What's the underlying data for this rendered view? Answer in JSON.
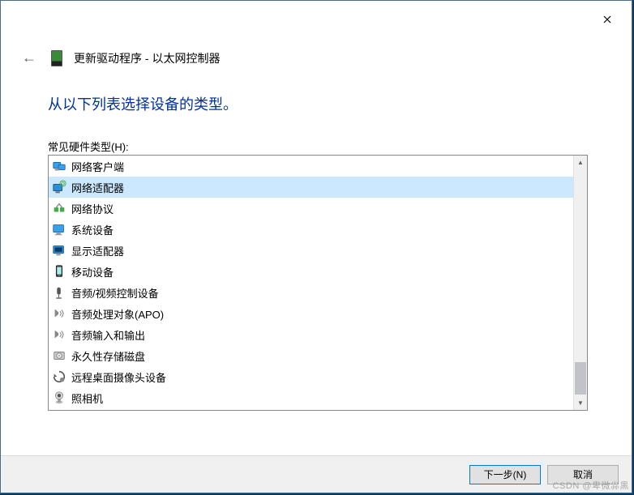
{
  "window": {
    "title": "更新驱动程序 - 以太网控制器"
  },
  "heading": "从以下列表选择设备的类型。",
  "list_label": "常见硬件类型(H):",
  "items": [
    {
      "icon": "network-client-icon",
      "label": "网络客户端",
      "selected": false
    },
    {
      "icon": "network-adapter-icon",
      "label": "网络适配器",
      "selected": true
    },
    {
      "icon": "network-protocol-icon",
      "label": "网络协议",
      "selected": false
    },
    {
      "icon": "system-device-icon",
      "label": "系统设备",
      "selected": false
    },
    {
      "icon": "display-adapter-icon",
      "label": "显示适配器",
      "selected": false
    },
    {
      "icon": "mobile-device-icon",
      "label": "移动设备",
      "selected": false
    },
    {
      "icon": "av-controller-icon",
      "label": "音频/视频控制设备",
      "selected": false
    },
    {
      "icon": "apo-icon",
      "label": "音频处理对象(APO)",
      "selected": false
    },
    {
      "icon": "audio-io-icon",
      "label": "音频输入和输出",
      "selected": false
    },
    {
      "icon": "storage-disk-icon",
      "label": "永久性存储磁盘",
      "selected": false
    },
    {
      "icon": "remote-camera-icon",
      "label": "远程桌面摄像头设备",
      "selected": false
    },
    {
      "icon": "camera-icon",
      "label": "照相机",
      "selected": false
    }
  ],
  "buttons": {
    "next": "下一步(N)",
    "cancel": "取消"
  },
  "watermark": "CSDN @卑微尛黑"
}
